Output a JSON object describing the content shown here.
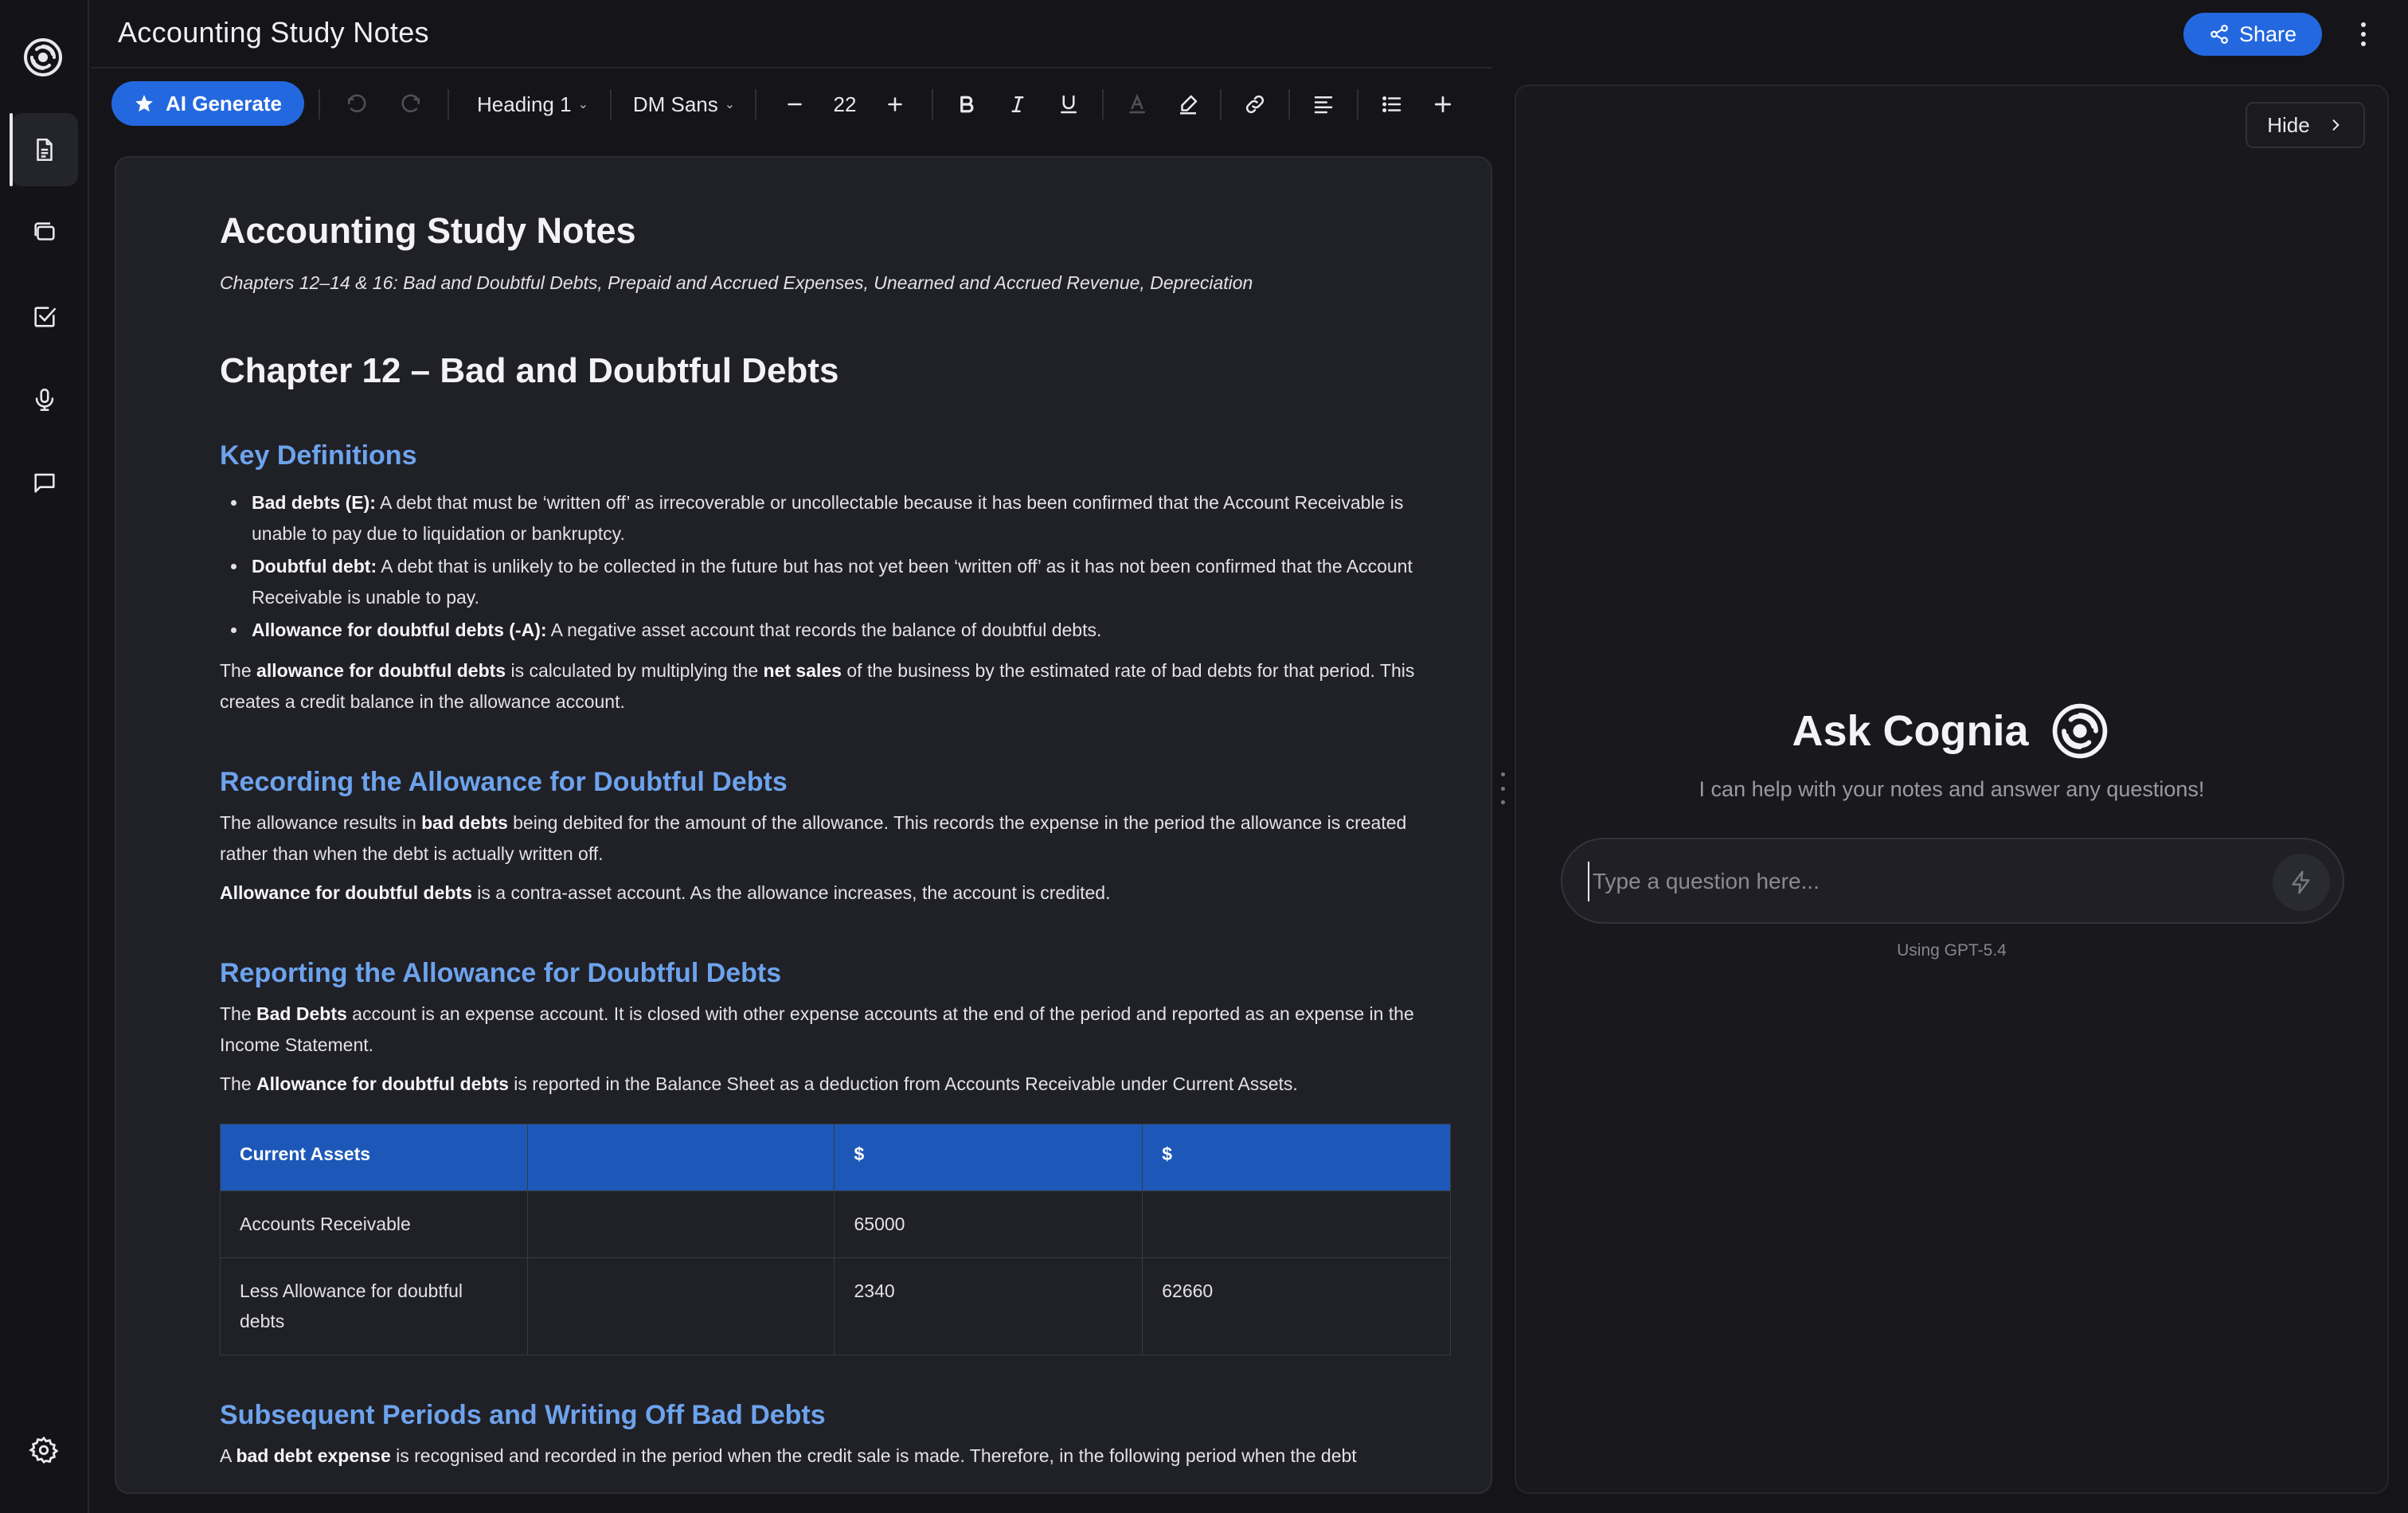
{
  "app": {
    "title": "Accounting Study Notes"
  },
  "header": {
    "share_label": "Share"
  },
  "sidebar": {
    "items": [
      {
        "name": "notes",
        "icon": "document-icon",
        "active": true
      },
      {
        "name": "flashcards",
        "icon": "cards-icon",
        "active": false
      },
      {
        "name": "quiz",
        "icon": "checkbox-icon",
        "active": false
      },
      {
        "name": "recording",
        "icon": "microphone-icon",
        "active": false
      },
      {
        "name": "chat",
        "icon": "chat-bubble-icon",
        "active": false
      }
    ],
    "settings_icon": "gear-icon"
  },
  "toolbar": {
    "ai_generate_label": "AI Generate",
    "heading_style": "Heading 1",
    "font_family": "DM Sans",
    "font_size": "22",
    "accent_color": "#2468e0"
  },
  "document": {
    "title": "Accounting Study Notes",
    "subtitle": "Chapters 12–14 & 16: Bad and Doubtful Debts, Prepaid and Accrued Expenses, Unearned and Accrued Revenue, Depreciation",
    "chapter_heading": "Chapter 12 – Bad and Doubtful Debts",
    "sections": {
      "key_definitions": {
        "heading": "Key Definitions",
        "bullets": [
          {
            "term": "Bad debts (E):",
            "text": " A debt that must be ‘written off’ as irrecoverable or uncollectable because it has been confirmed that the Account Receivable is unable to pay due to liquidation or bankruptcy."
          },
          {
            "term": "Doubtful debt:",
            "text": " A debt that is unlikely to be collected in the future but has not yet been ‘written off’ as it has not been confirmed that the Account Receivable is unable to pay."
          },
          {
            "term": "Allowance for doubtful debts (-A):",
            "text": " A negative asset account that records the balance of doubtful debts."
          }
        ],
        "para": {
          "t1": "The ",
          "b1": "allowance for doubtful debts",
          "t2": " is calculated by multiplying the ",
          "b2": "net sales",
          "t3": " of the business by the estimated rate of bad debts for that period. This creates a credit balance in the allowance account."
        }
      },
      "recording": {
        "heading": "Recording the Allowance for Doubtful Debts",
        "p1": {
          "t1": "The allowance results in ",
          "b1": "bad debts",
          "t2": " being debited for the amount of the allowance. This records the expense in the period the allowance is created rather than when the debt is actually written off."
        },
        "p2": {
          "b1": "Allowance for doubtful debts",
          "t1": " is a contra-asset account. As the allowance increases, the account is credited."
        }
      },
      "reporting": {
        "heading": "Reporting the Allowance for Doubtful Debts",
        "p1": {
          "t1": "The ",
          "b1": "Bad Debts",
          "t2": " account is an expense account. It is closed with other expense accounts at the end of the period and reported as an expense in the Income Statement."
        },
        "p2": {
          "t1": "The ",
          "b1": "Allowance for doubtful debts",
          "t2": " is reported in the Balance Sheet as a deduction from Accounts Receivable under Current Assets."
        },
        "table": {
          "headers": [
            "Current Assets",
            "",
            "$",
            "$"
          ],
          "rows": [
            [
              "Accounts Receivable",
              "",
              "65000",
              ""
            ],
            [
              "Less Allowance for doubtful debts",
              "",
              "2340",
              "62660"
            ]
          ],
          "header_color": "#1d58b8"
        }
      },
      "subsequent": {
        "heading": "Subsequent Periods and Writing Off Bad Debts",
        "p1": {
          "t1": "A ",
          "b1": "bad debt expense",
          "t2": " is recognised and recorded in the period when the credit sale is made. Therefore, in the following period when the debt"
        }
      }
    }
  },
  "chat_panel": {
    "hide_label": "Hide",
    "title": "Ask Cognia",
    "subtitle": "I can help with your notes and answer any questions!",
    "input_placeholder": "Type a question here...",
    "model_note": "Using GPT-5.4"
  }
}
